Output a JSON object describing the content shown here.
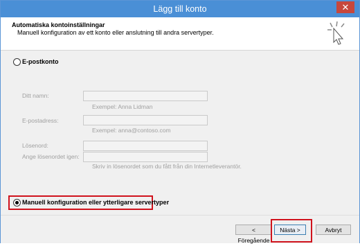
{
  "window": {
    "title": "Lägg till konto",
    "close_label": "✕"
  },
  "header": {
    "title": "Automatiska kontoinställningar",
    "subtitle": "Manuell konfiguration av ett konto eller anslutning till andra servertyper."
  },
  "options": {
    "email_account_label": "E-postkonto",
    "manual_label": "Manuell konfiguration eller ytterligare servertyper"
  },
  "form": {
    "name_label": "Ditt namn:",
    "name_hint": "Exempel: Anna Lidman",
    "email_label": "E-postadress:",
    "email_hint": "Exempel: anna@contoso.com",
    "password_label": "Lösenord:",
    "password_confirm_label": "Ange lösenordet igen:",
    "password_hint": "Skriv in lösenordet som du fått från din Internetleverantör."
  },
  "footer": {
    "back_label": "< Föregående",
    "next_label": "Nästa >",
    "cancel_label": "Avbryt"
  },
  "colors": {
    "titlebar": "#4a8fd6",
    "highlight": "#d0121c",
    "close": "#c7473c"
  },
  "icons": {
    "wizard": "wizard-sparkle-icon",
    "close": "close-icon"
  }
}
